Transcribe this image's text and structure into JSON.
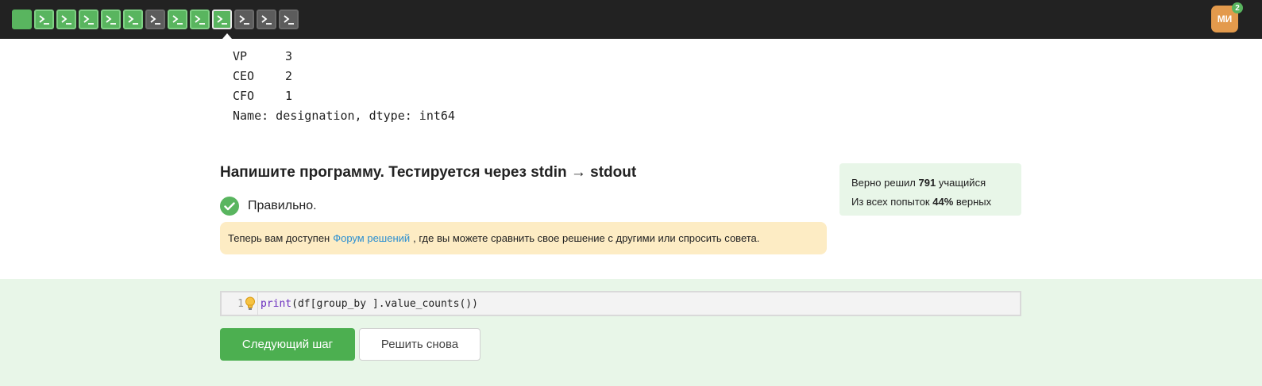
{
  "topbar": {
    "steps": [
      {
        "type": "plain",
        "status": "passed"
      },
      {
        "type": "terminal-icon",
        "status": "passed"
      },
      {
        "type": "terminal-icon",
        "status": "passed"
      },
      {
        "type": "terminal-icon",
        "status": "passed"
      },
      {
        "type": "terminal-icon",
        "status": "passed"
      },
      {
        "type": "terminal-icon",
        "status": "passed"
      },
      {
        "type": "terminal-icon",
        "status": "not-started"
      },
      {
        "type": "terminal-icon",
        "status": "passed"
      },
      {
        "type": "terminal-icon",
        "status": "passed"
      },
      {
        "type": "terminal-icon",
        "status": "passed-current"
      },
      {
        "type": "terminal-icon",
        "status": "not-started"
      },
      {
        "type": "terminal-icon",
        "status": "not-started"
      },
      {
        "type": "terminal-icon",
        "status": "not-started"
      }
    ],
    "avatar": {
      "initials": "МИ",
      "badge": "2"
    }
  },
  "sample_output": {
    "rows": [
      {
        "key": "VP",
        "value": "3"
      },
      {
        "key": "CEO",
        "value": "2"
      },
      {
        "key": "CFO",
        "value": "1"
      }
    ],
    "footer": "Name: designation, dtype: int64"
  },
  "task": {
    "title": "Напишите программу. Тестируется через stdin → stdout",
    "verdict": "Правильно."
  },
  "notice": {
    "before": "Теперь вам доступен",
    "link": "Форум решений",
    "after": ", где вы можете сравнить свое решение с другими или спросить совета."
  },
  "stats": {
    "line1_prefix": "Верно решил",
    "line1_count": "791",
    "line1_suffix": "учащийся",
    "line2_prefix": "Из всех попыток",
    "line2_percent": "44%",
    "line2_suffix": "верных"
  },
  "editor": {
    "line_number": "1",
    "code_keyword": "print",
    "code_rest": "(df[group_by ].value_counts())"
  },
  "buttons": {
    "next": "Следующий шаг",
    "retry": "Решить снова"
  },
  "colors": {
    "topbar": "#222222",
    "passed": "#59b55f",
    "not_started": "#5c5c5c",
    "avatar": "#e39a4c",
    "notice_bg": "#fdecc4",
    "stats_bg": "#e8f6e8",
    "link": "#2b8fd1"
  }
}
